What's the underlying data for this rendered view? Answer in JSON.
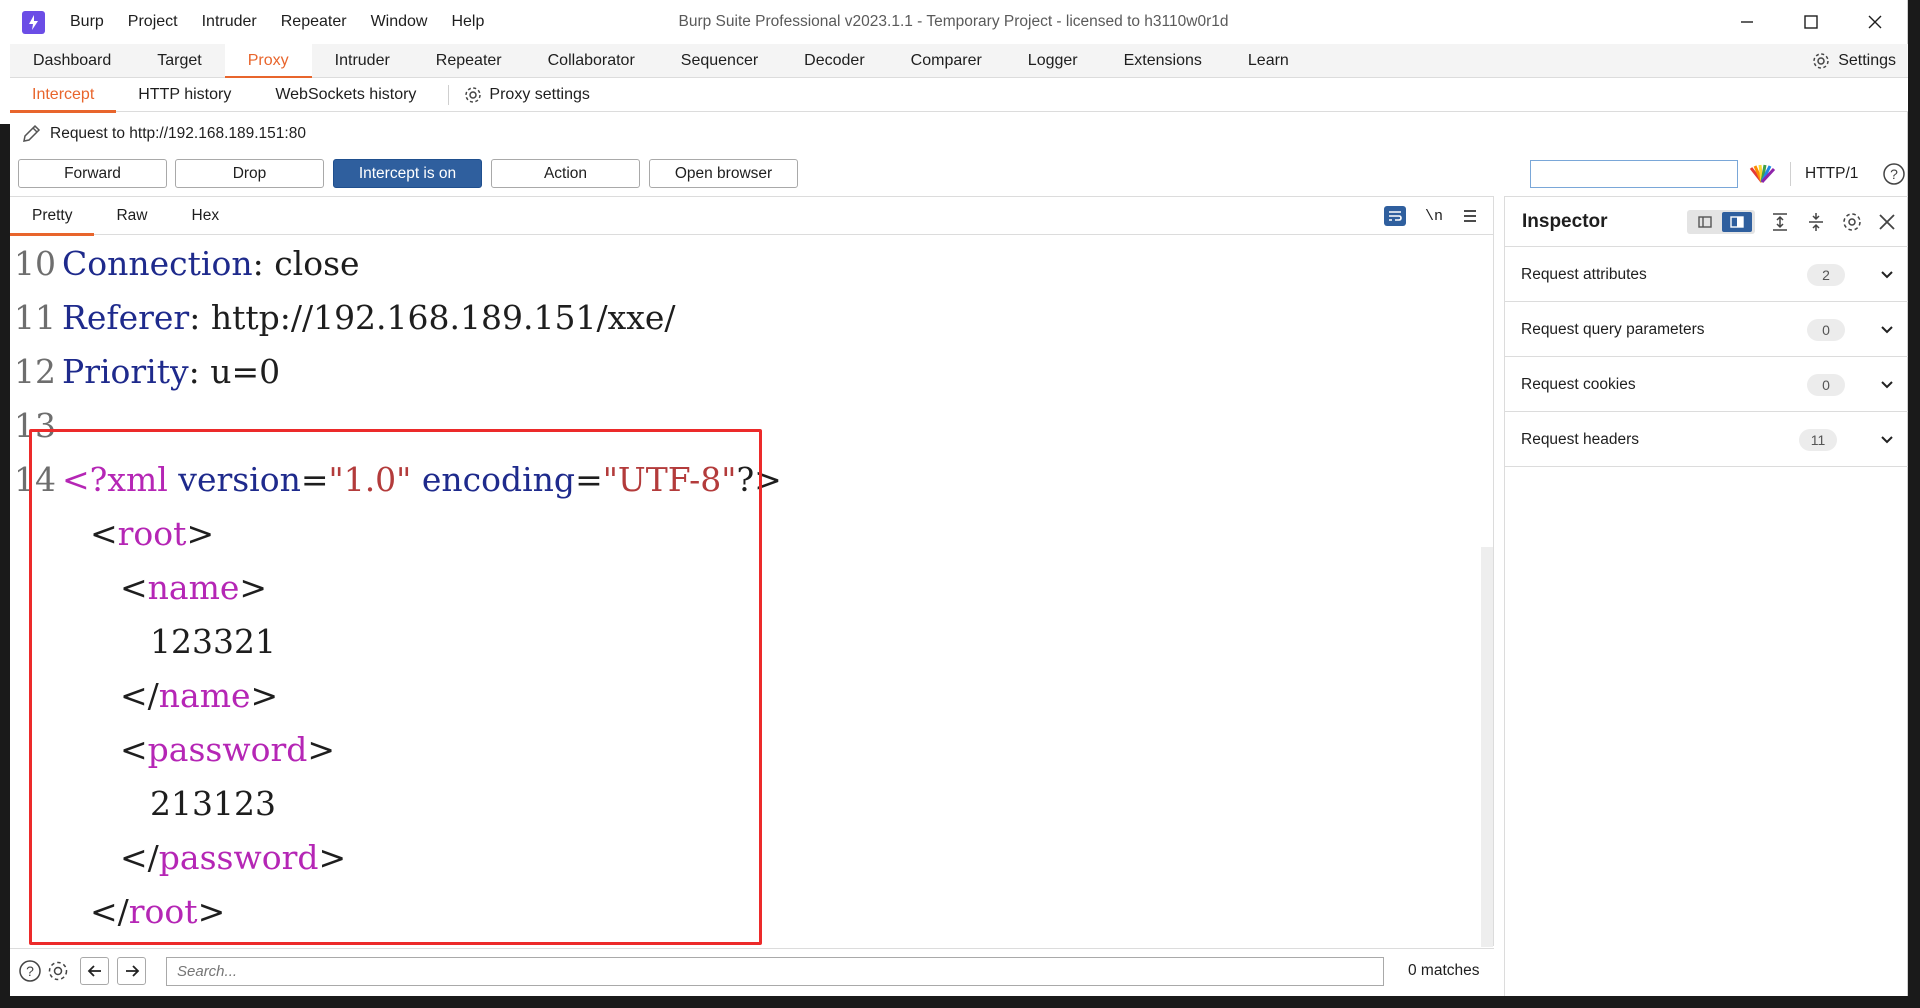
{
  "app": {
    "title": "Burp Suite Professional v2023.1.1 - Temporary Project - licensed to h3110w0r1d",
    "menu": [
      "Burp",
      "Project",
      "Intruder",
      "Repeater",
      "Window",
      "Help"
    ]
  },
  "main_tabs": [
    "Dashboard",
    "Target",
    "Proxy",
    "Intruder",
    "Repeater",
    "Collaborator",
    "Sequencer",
    "Decoder",
    "Comparer",
    "Logger",
    "Extensions",
    "Learn"
  ],
  "main_tab_active": "Proxy",
  "settings_label": "Settings",
  "sub_tabs": [
    "Intercept",
    "HTTP history",
    "WebSockets history"
  ],
  "proxy_settings_label": "Proxy settings",
  "request": {
    "label": "Request to http://192.168.189.151:80"
  },
  "actions": {
    "forward": "Forward",
    "drop": "Drop",
    "intercept": "Intercept is on",
    "action": "Action",
    "open_browser": "Open browser",
    "protocol": "HTTP/1"
  },
  "editor": {
    "tabs": [
      "Pretty",
      "Raw",
      "Hex"
    ],
    "newline_toggle": "\\n",
    "lines": [
      {
        "n": "10",
        "key": "Connection",
        "sep": ": ",
        "val": "close"
      },
      {
        "n": "11",
        "key": "Referer",
        "sep": ": ",
        "val": "http://192.168.189.151/xxe/"
      },
      {
        "n": "12",
        "key": "Priority",
        "sep": ": ",
        "val": "u=0"
      },
      {
        "n": "13"
      },
      {
        "n": "14"
      }
    ],
    "xml": {
      "decl_open": "<?xml ",
      "version_attr": "version",
      "eq": "=",
      "version_val": "\"1.0\"",
      "encoding_attr": "encoding",
      "encoding_val": "\"UTF-8\"",
      "decl_close": "?>",
      "root_open_lt": "<",
      "root_name": "root",
      "gt": ">",
      "name_name": "name",
      "name_value": "123321",
      "close_lt": "</",
      "password_name": "password",
      "password_value": "213123"
    }
  },
  "search": {
    "placeholder": "Search...",
    "matches": "0 matches"
  },
  "inspector": {
    "title": "Inspector",
    "rows": [
      {
        "label": "Request attributes",
        "count": "2"
      },
      {
        "label": "Request query parameters",
        "count": "0"
      },
      {
        "label": "Request cookies",
        "count": "0"
      },
      {
        "label": "Request headers",
        "count": "11"
      }
    ]
  },
  "colors": {
    "accent": "#e8652c",
    "primary_button": "#2f5f9e",
    "highlight": "#ec2a2a",
    "logo": "#6b4de6"
  }
}
